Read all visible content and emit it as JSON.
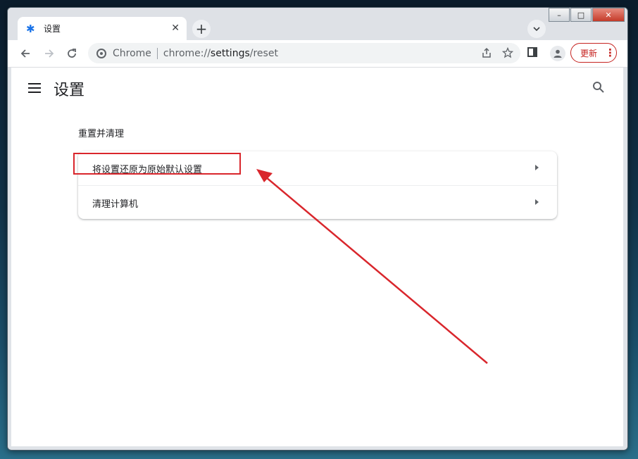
{
  "browser": {
    "tab_title": "设置",
    "site_label": "Chrome",
    "url_prefix": "chrome://",
    "url_path": "settings",
    "url_suffix": "/reset",
    "update_label": "更新"
  },
  "page": {
    "title": "设置",
    "section_title": "重置并清理",
    "items": [
      {
        "label": "将设置还原为原始默认设置"
      },
      {
        "label": "清理计算机"
      }
    ]
  },
  "annotation": {
    "color": "#d9262c",
    "highlighted_item": "将设置还原为原始默认设置"
  },
  "icons": {
    "tab": "gear-icon",
    "back": "back-arrow-icon",
    "forward": "forward-arrow-icon",
    "reload": "reload-icon",
    "share": "share-icon",
    "bookmark": "star-icon",
    "menu": "hamburger-menu-icon",
    "search": "search-icon"
  }
}
